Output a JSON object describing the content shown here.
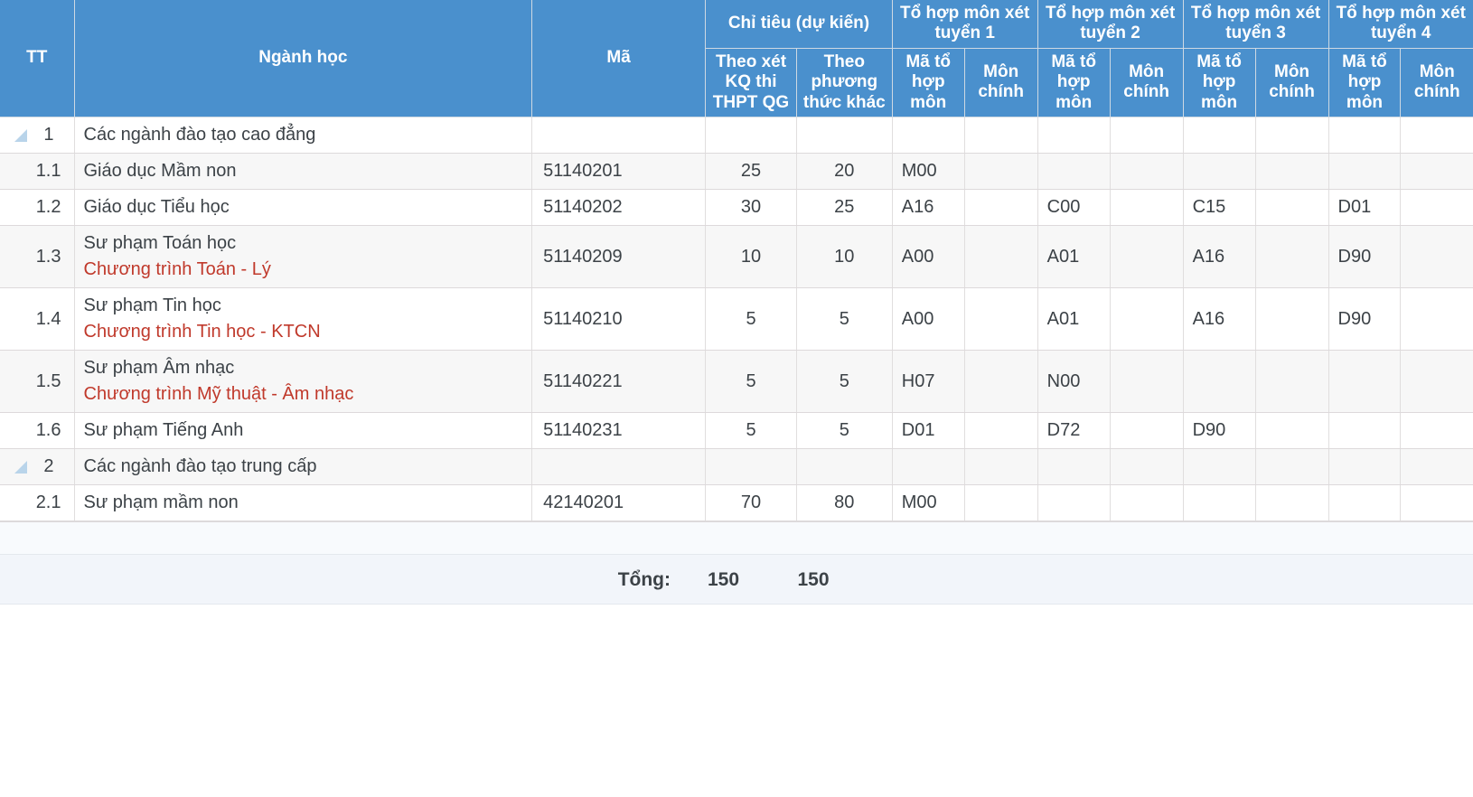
{
  "table": {
    "header": {
      "tt": "TT",
      "nganh_hoc": "Ngành học",
      "ma": "Mã",
      "chi_tieu_group": "Chỉ tiêu (dự kiến)",
      "theo_xet_kq": "Theo xét KQ thi THPT QG",
      "theo_phuong_thuc_khac": "Theo phương thức khác",
      "combos": [
        {
          "group": "Tổ hợp môn xét tuyển 1",
          "code_label": "Mã tổ hợp môn",
          "main_label": "Môn chính"
        },
        {
          "group": "Tổ hợp môn xét tuyển 2",
          "code_label": "Mã tổ hợp môn",
          "main_label": "Môn chính"
        },
        {
          "group": "Tổ hợp môn xét tuyển 3",
          "code_label": "Mã tổ hợp môn",
          "main_label": "Môn chính"
        },
        {
          "group": "Tổ hợp môn xét tuyển 4",
          "code_label": "Mã tổ hợp môn",
          "main_label": "Môn chính"
        }
      ]
    },
    "rows": [
      {
        "type": "group",
        "tt": "1",
        "name": "Các ngành đào tạo cao đẳng",
        "name_sub": "",
        "ma": "",
        "theo_xet_kq": "",
        "theo_khac": "",
        "c1_code": "",
        "c1_main": "",
        "c2_code": "",
        "c2_main": "",
        "c3_code": "",
        "c3_main": "",
        "c4_code": "",
        "c4_main": ""
      },
      {
        "type": "item",
        "tt": "1.1",
        "name": "Giáo dục Mầm non",
        "name_sub": "",
        "ma": "51140201",
        "theo_xet_kq": "25",
        "theo_khac": "20",
        "c1_code": "M00",
        "c1_main": "",
        "c2_code": "",
        "c2_main": "",
        "c3_code": "",
        "c3_main": "",
        "c4_code": "",
        "c4_main": ""
      },
      {
        "type": "item",
        "tt": "1.2",
        "name": "Giáo dục Tiểu học",
        "name_sub": "",
        "ma": "51140202",
        "theo_xet_kq": "30",
        "theo_khac": "25",
        "c1_code": "A16",
        "c1_main": "",
        "c2_code": "C00",
        "c2_main": "",
        "c3_code": "C15",
        "c3_main": "",
        "c4_code": "D01",
        "c4_main": ""
      },
      {
        "type": "item",
        "tt": "1.3",
        "name": "Sư phạm Toán học",
        "name_sub": "Chương trình Toán - Lý",
        "ma": "51140209",
        "theo_xet_kq": "10",
        "theo_khac": "10",
        "c1_code": "A00",
        "c1_main": "",
        "c2_code": "A01",
        "c2_main": "",
        "c3_code": "A16",
        "c3_main": "",
        "c4_code": "D90",
        "c4_main": ""
      },
      {
        "type": "item",
        "tt": "1.4",
        "name": "Sư phạm Tin học",
        "name_sub": "Chương trình Tin học - KTCN",
        "ma": "51140210",
        "theo_xet_kq": "5",
        "theo_khac": "5",
        "c1_code": "A00",
        "c1_main": "",
        "c2_code": "A01",
        "c2_main": "",
        "c3_code": "A16",
        "c3_main": "",
        "c4_code": "D90",
        "c4_main": ""
      },
      {
        "type": "item",
        "tt": "1.5",
        "name": "Sư phạm Âm nhạc",
        "name_sub": "Chương trình Mỹ thuật - Âm nhạc",
        "ma": "51140221",
        "theo_xet_kq": "5",
        "theo_khac": "5",
        "c1_code": "H07",
        "c1_main": "",
        "c2_code": "N00",
        "c2_main": "",
        "c3_code": "",
        "c3_main": "",
        "c4_code": "",
        "c4_main": ""
      },
      {
        "type": "item",
        "tt": "1.6",
        "name": "Sư phạm Tiếng Anh",
        "name_sub": "",
        "ma": "51140231",
        "theo_xet_kq": "5",
        "theo_khac": "5",
        "c1_code": "D01",
        "c1_main": "",
        "c2_code": "D72",
        "c2_main": "",
        "c3_code": "D90",
        "c3_main": "",
        "c4_code": "",
        "c4_main": ""
      },
      {
        "type": "group",
        "tt": "2",
        "name": "Các ngành đào tạo trung cấp",
        "name_sub": "",
        "ma": "",
        "theo_xet_kq": "",
        "theo_khac": "",
        "c1_code": "",
        "c1_main": "",
        "c2_code": "",
        "c2_main": "",
        "c3_code": "",
        "c3_main": "",
        "c4_code": "",
        "c4_main": ""
      },
      {
        "type": "item",
        "tt": "2.1",
        "name": "Sư phạm mầm non",
        "name_sub": "",
        "ma": "42140201",
        "theo_xet_kq": "70",
        "theo_khac": "80",
        "c1_code": "M00",
        "c1_main": "",
        "c2_code": "",
        "c2_main": "",
        "c3_code": "",
        "c3_main": "",
        "c4_code": "",
        "c4_main": ""
      }
    ],
    "footer": {
      "total_label": "Tổng:",
      "total_theo_xet_kq": "150",
      "total_theo_khac": "150"
    }
  },
  "colors": {
    "header_blue": "#4a90cd",
    "red_note": "#c0392b",
    "row_alt": "#f7f7f7",
    "footer_bg": "#f2f5fa",
    "collapse_icon": "#b9d4ea"
  },
  "icons": {
    "collapse": "collapse-triangle-icon"
  }
}
